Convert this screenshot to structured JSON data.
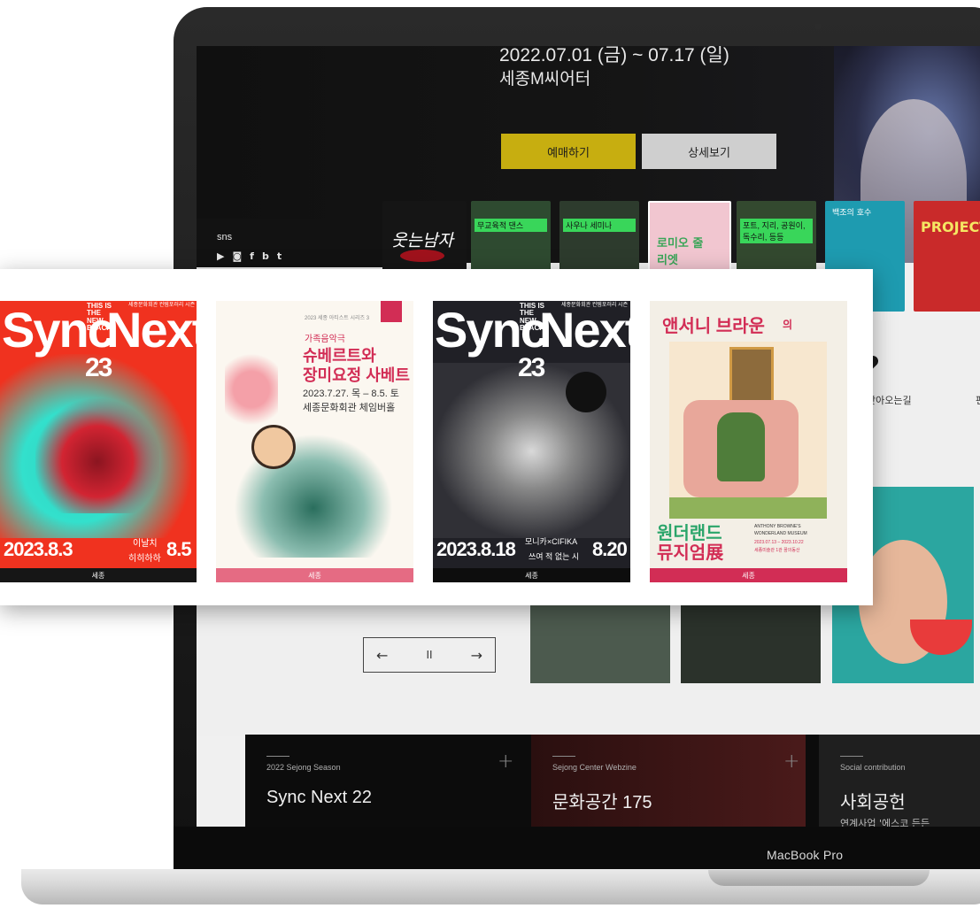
{
  "hero": {
    "date": "2022.07.01 (금) ~ 07.17 (일)",
    "venue": "세종M씨어터",
    "reserve_label": "예매하기",
    "detail_label": "상세보기"
  },
  "sns": {
    "title": "sns",
    "icons": [
      "youtube-icon",
      "instagram-icon",
      "facebook-icon",
      "blog-icon",
      "twitter-icon"
    ]
  },
  "thumbnails": [
    {
      "text": "웃는남자",
      "color": "#1a1a1a"
    },
    {
      "text": "무교육적 댄스",
      "color": "#2e4a30"
    },
    {
      "text": "사우나 세미나",
      "color": "#2d3b2d"
    },
    {
      "text": "로미오 줄리엣",
      "color": "#f1c6d0"
    },
    {
      "text": "포트, 지리, 공원이, 독수리, 등등",
      "color": "#33492f"
    },
    {
      "text": "백조의 호수",
      "color": "#1e9bb0"
    },
    {
      "text": "PROJECT",
      "color": "#c92a2a"
    }
  ],
  "location": {
    "label": "찾아오는길",
    "edge": "편"
  },
  "slider": {
    "prev": "←",
    "pause": "II",
    "next": "→"
  },
  "cards": [
    {
      "category": "2022 Sejong Season",
      "title": "Sync Next 22",
      "sub": ""
    },
    {
      "category": "Sejong Center Webzine",
      "title": "문화공간 175",
      "sub": ""
    },
    {
      "category": "Social contribution",
      "title": "사회공헌",
      "sub": "연계사업 '에스코 든든"
    }
  ],
  "device": {
    "brand": "MacBook Pro"
  },
  "posters": [
    {
      "id": "sync-next-a",
      "headline_left": "Sync",
      "headline_right": "Next",
      "tag": "THIS IS THE NEW BLACK",
      "num": "23",
      "org": "세종문화회관 컨템포러리 시즌",
      "date_left": "2023.8.3",
      "artist_1": "이날치",
      "artist_2": "히히하하",
      "date_right": "8.5",
      "footer": "세종"
    },
    {
      "id": "schubert",
      "top_note": "2023 세종 아티스트 시리즈 3",
      "kicker": "가족음악극",
      "title_1": "슈베르트와",
      "title_2": "장미요정 사베트",
      "date": "2023.7.27. 목 – 8.5. 토",
      "venue": "세종문화회관 체임버홀",
      "footer": "세종"
    },
    {
      "id": "sync-next-b",
      "headline_left": "Sync",
      "headline_right": "Next",
      "tag": "THIS IS THE NEW BLACK",
      "num": "23",
      "org": "세종문화회관 컨템포러리 시즌",
      "date_left": "2023.8.18",
      "artist_1": "모니카×CIFIKA",
      "artist_2": "쓰여 적 없는 시",
      "date_right": "8.20",
      "footer": "세종"
    },
    {
      "id": "anthony-browne",
      "title_1": "앤서니 브라운",
      "title_suffix": "의",
      "title_2": "원더랜드",
      "title_3": "뮤지엄展",
      "en_1": "ANTHONY BROWNE'S",
      "en_2": "WONDERLAND MUSEUM",
      "dates": "2023.07.13 – 2023.10.22",
      "venue": "세종미술관 1관 꿈의동산",
      "footer": "세종"
    }
  ]
}
